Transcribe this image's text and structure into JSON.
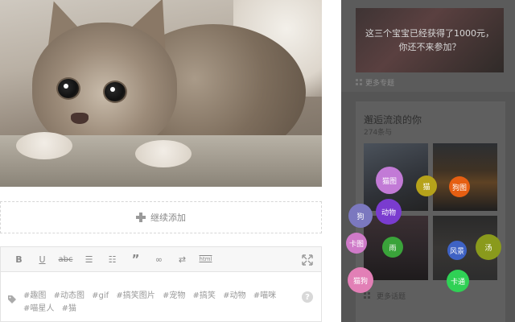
{
  "editor": {
    "add_more_label": "继续添加",
    "toolbar": {
      "bold": "B",
      "underline": "U",
      "strike": "abc",
      "bullet_list": "☰",
      "numbered_list": "☷",
      "quote": "”",
      "link": "∞",
      "unlink": "⇄",
      "html": "html"
    },
    "tags": [
      "#趣图",
      "#动态图",
      "#gif",
      "#搞笑图片",
      "#宠物",
      "#搞笑",
      "#动物",
      "#喵咪",
      "#喵星人",
      "#猫"
    ],
    "help": "?"
  },
  "sidebar": {
    "banner_text": "这三个宝宝已经获得了1000元，你还不来参加？",
    "more_topics": "更多专题",
    "card_title": "邂逅流浪的你",
    "card_count": "274条与",
    "more_songs": "更多话题"
  },
  "bubbles": [
    {
      "label": "猫图",
      "color": "#c27ad6"
    },
    {
      "label": "猫",
      "color": "#b6a21a"
    },
    {
      "label": "狗图",
      "color": "#e65f12"
    },
    {
      "label": "动物",
      "color": "#7a3ccf"
    },
    {
      "label": "狗",
      "color": "#7b78bf"
    },
    {
      "label": "卡图",
      "color": "#cf7ac8"
    },
    {
      "label": "雨",
      "color": "#3aa33a"
    },
    {
      "label": "风景",
      "color": "#3e62c4"
    },
    {
      "label": "汤",
      "color": "#8a9a1c"
    },
    {
      "label": "猫狗",
      "color": "#e27fb6"
    },
    {
      "label": "卡通",
      "color": "#2fd155"
    }
  ]
}
